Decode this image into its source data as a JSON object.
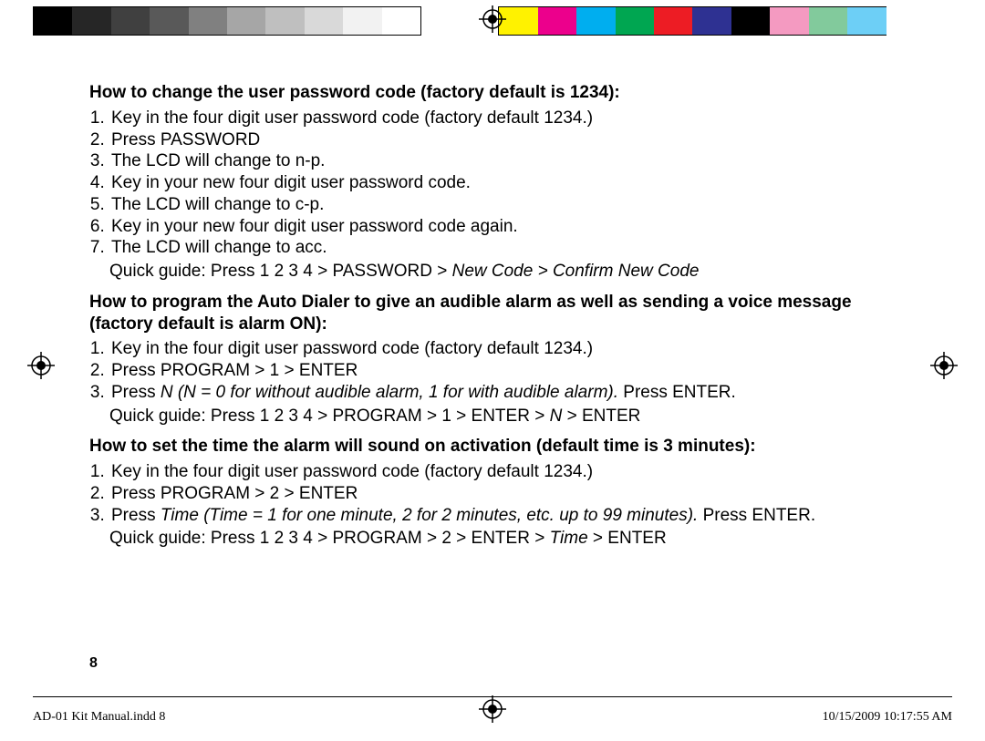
{
  "colorbar": {
    "left": [
      "#000000",
      "#262626",
      "#404040",
      "#595959",
      "#808080",
      "#a6a6a6",
      "#bfbfbf",
      "#d9d9d9",
      "#f2f2f2",
      "#ffffff"
    ],
    "right": [
      "#fff200",
      "#ec008c",
      "#00aeef",
      "#00a651",
      "#ed1c24",
      "#2e3192",
      "#000000",
      "#f49ac1",
      "#82ca9c",
      "#6dcff6"
    ]
  },
  "sections": [
    {
      "heading": "How to change the user password code (factory default is 1234):",
      "steps": [
        "Key in the four digit user password code (factory default 1234.)",
        "Press PASSWORD",
        "The LCD will change to n-p.",
        "Key in your new four digit user password code.",
        "The LCD will change to c-p.",
        "Key in your new four digit user password code again.",
        "The LCD will change to acc."
      ],
      "quick_pre": "Quick guide: Press 1 2 3 4 > PASSWORD > ",
      "quick_ital": "New Code > Confirm New Code",
      "quick_post": ""
    },
    {
      "heading": "How to program the Auto Dialer to give an audible alarm as well as sending a voice message (factory default is alarm ON):",
      "steps": [
        "Key in the four digit user password code (factory default 1234.)",
        "Press PROGRAM > 1 > ENTER"
      ],
      "mixed": {
        "pre": "Press ",
        "ital": "N (N = 0 for without audible alarm, 1 for with audible alarm).",
        "post": " Press ENTER."
      },
      "quick_pre": "Quick guide: Press 1 2 3 4 > PROGRAM > 1 > ENTER > ",
      "quick_ital": "N",
      "quick_post": " > ENTER"
    },
    {
      "heading": "How to set the time the alarm will sound on activation (default time is 3 minutes):",
      "steps": [
        "Key in the four digit user password code (factory default 1234.)",
        "Press PROGRAM > 2 > ENTER"
      ],
      "mixed": {
        "pre": "Press ",
        "ital": "Time (Time = 1 for one minute, 2 for 2 minutes, etc. up to 99 minutes).",
        "post": " Press ENTER."
      },
      "quick_pre": "Quick guide: Press 1 2 3 4 > PROGRAM > 2 > ENTER > ",
      "quick_ital": "Time",
      "quick_post": " > ENTER"
    }
  ],
  "page_number": "8",
  "footer": {
    "left": "AD-01 Kit Manual.indd   8",
    "right": "10/15/2009   10:17:55 AM"
  }
}
